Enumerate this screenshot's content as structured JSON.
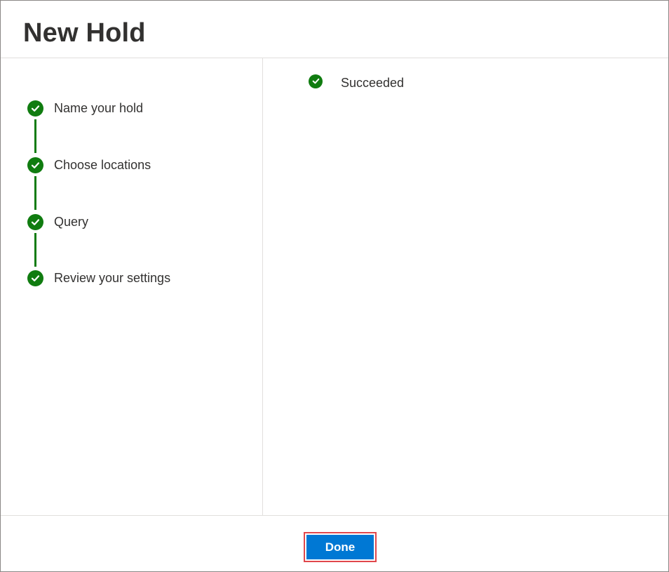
{
  "dialog": {
    "title": "New Hold"
  },
  "steps": [
    {
      "label": "Name your hold",
      "status": "complete",
      "icon": "check-circle-icon"
    },
    {
      "label": "Choose locations",
      "status": "complete",
      "icon": "check-circle-icon"
    },
    {
      "label": "Query",
      "status": "complete",
      "icon": "check-circle-icon"
    },
    {
      "label": "Review your settings",
      "status": "complete",
      "icon": "check-circle-icon"
    }
  ],
  "result": {
    "status_label": "Succeeded",
    "icon": "check-circle-icon"
  },
  "footer": {
    "done_label": "Done"
  },
  "colors": {
    "success": "#107c10",
    "primary_button": "#0078d4",
    "focus_outline": "#e0474c"
  }
}
